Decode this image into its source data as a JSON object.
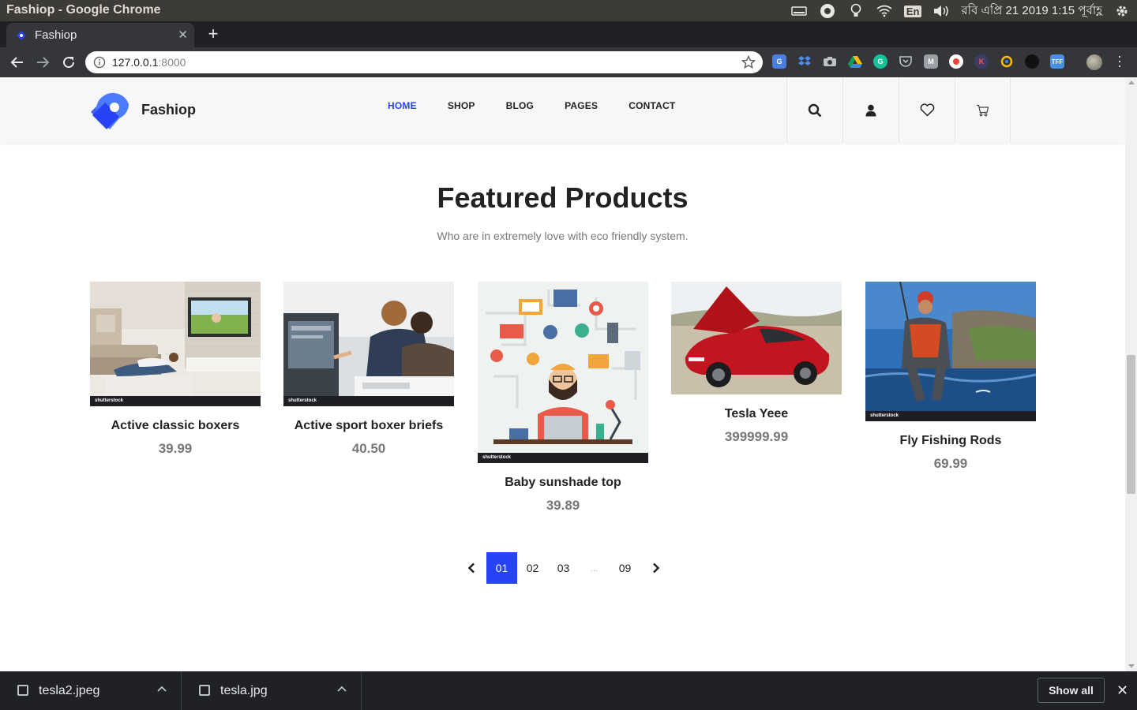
{
  "os": {
    "window_title": "Fashiop - Google Chrome",
    "lang": "En",
    "clock": "রবি এপ্রি 21 2019  1:15 পূর্বাহ্ণ"
  },
  "browser": {
    "tab_title": "Fashiop",
    "url_host": "127.0.0.1",
    "url_port": ":8000",
    "extensions": [
      "google-translate",
      "dropbox",
      "camera",
      "google-drive",
      "grammarly",
      "pocket",
      "gmail",
      "record",
      "k",
      "q",
      "dark",
      "tff"
    ]
  },
  "site": {
    "brand": "Fashiop",
    "accent": "#2743f5",
    "nav": [
      {
        "label": "HOME",
        "active": true
      },
      {
        "label": "SHOP",
        "active": false
      },
      {
        "label": "BLOG",
        "active": false
      },
      {
        "label": "PAGES",
        "active": false
      },
      {
        "label": "CONTACT",
        "active": false
      }
    ],
    "header_icons": [
      "search-icon",
      "user-icon",
      "heart-icon",
      "cart-icon"
    ]
  },
  "featured": {
    "title": "Featured Products",
    "subtitle": "Who are in extremely love with eco friendly system.",
    "products": [
      {
        "name": "Active classic boxers",
        "price": "39.99",
        "image": "living-room-tv-photo"
      },
      {
        "name": "Active sport boxer briefs",
        "price": "40.50",
        "image": "office-computer-photo"
      },
      {
        "name": "Baby sunshade top",
        "price": "39.89",
        "image": "web-developer-illustration"
      },
      {
        "name": "Tesla Yeee",
        "price": "399999.99",
        "image": "red-tesla-car-photo"
      },
      {
        "name": "Fly Fishing Rods",
        "price": "69.99",
        "image": "fly-fishing-photo"
      }
    ],
    "watermark": "shutterstock"
  },
  "pagination": {
    "pages": [
      "01",
      "02",
      "03",
      "...",
      "09"
    ],
    "current": "01"
  },
  "downloads": {
    "items": [
      "tesla2.jpeg",
      "tesla.jpg"
    ],
    "show_all": "Show all"
  }
}
